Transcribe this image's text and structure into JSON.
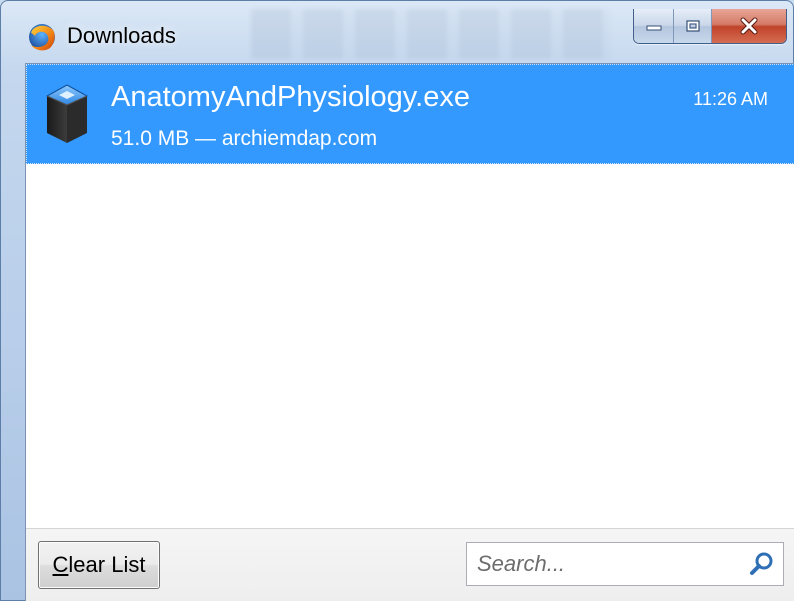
{
  "window": {
    "title": "Downloads",
    "app_icon": "firefox-icon",
    "caption_buttons": [
      "minimize-icon",
      "restore-icon",
      "close-icon"
    ]
  },
  "downloads": [
    {
      "file_name": "AnatomyAndPhysiology.exe",
      "status": "51.0 MB — archiemdap.com",
      "time": "11:26 AM",
      "icon": "package-box-icon",
      "selected": true
    }
  ],
  "footer": {
    "clear_button_access_key": "C",
    "clear_button_rest": "lear List",
    "search_placeholder": "Search..."
  },
  "colors": {
    "selection": "#3399ff",
    "close_button": "#c0432a",
    "frame": "#b7cde9"
  }
}
